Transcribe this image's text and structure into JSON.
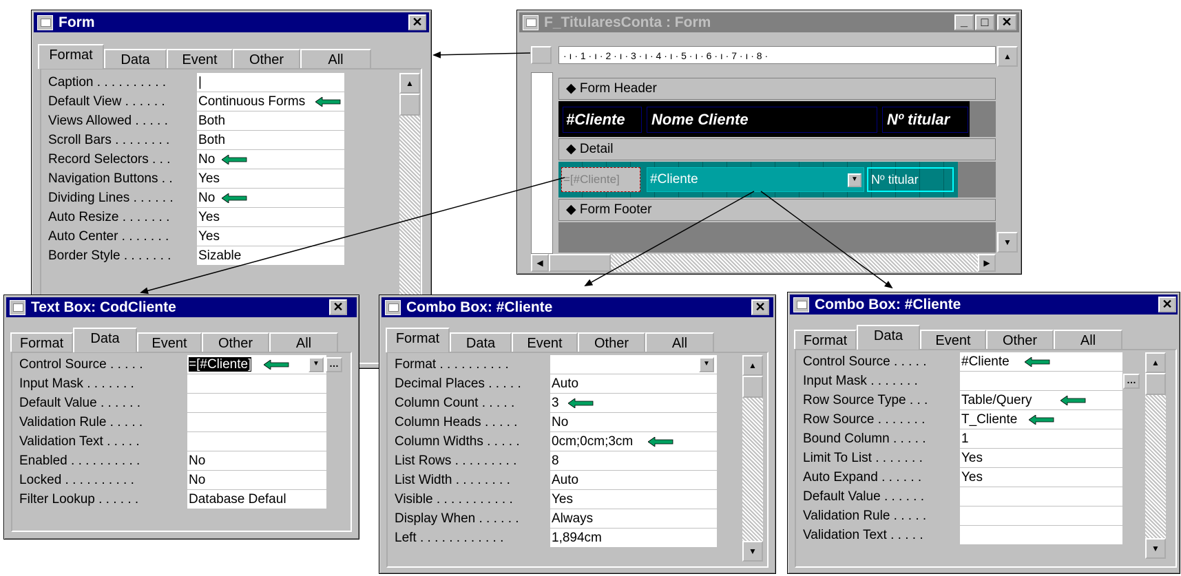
{
  "colors": {
    "titlebar": "#000080",
    "accent_arrow": "#00a060",
    "teal": "#008080",
    "detail_cell": "#00a0a0"
  },
  "form_props": {
    "title": "Form",
    "tabs": [
      "Format",
      "Data",
      "Event",
      "Other",
      "All"
    ],
    "active_tab": "Format",
    "rows": [
      {
        "label": "Caption . . . . . . . . . .",
        "value": "|"
      },
      {
        "label": "Default View . . . . . .",
        "value": "Continuous Forms",
        "arrow": true
      },
      {
        "label": "Views Allowed . . . . .",
        "value": "Both"
      },
      {
        "label": "Scroll Bars . . . . . . . .",
        "value": "Both"
      },
      {
        "label": "Record Selectors . . .",
        "value": "No",
        "arrow": true
      },
      {
        "label": "Navigation Buttons . .",
        "value": "Yes"
      },
      {
        "label": "Dividing Lines . . . . . .",
        "value": "No",
        "arrow": true
      },
      {
        "label": "Auto Resize . . . . . . .",
        "value": "Yes"
      },
      {
        "label": "Auto Center . . . . . . .",
        "value": "Yes"
      },
      {
        "label": "Border Style . . . . . . .",
        "value": "Sizable"
      }
    ]
  },
  "form_design": {
    "title": "F_TitularesConta : Form",
    "ruler": "· ı · 1 · ı · 2 · ı · 3 · ı · 4 · ı · 5 · ı · 6 · ı · 7 · ı · 8 ·",
    "header_label": "Form Header",
    "detail_label": "Detail",
    "footer_label": "Form Footer",
    "header_cells": [
      "#Cliente",
      "Nome Cliente",
      "Nº titular"
    ],
    "detail_cells": [
      "=[#Cliente]",
      "#Cliente",
      "Nº titular"
    ]
  },
  "textbox_props": {
    "title": "Text Box: CodCliente",
    "tabs": [
      "Format",
      "Data",
      "Event",
      "Other",
      "All"
    ],
    "active_tab": "Data",
    "rows": [
      {
        "label": "Control Source . . . . .",
        "value": "=[#Cliente]",
        "arrow": true
      },
      {
        "label": "Input Mask . . . . . . .",
        "value": ""
      },
      {
        "label": "Default Value . . . . . .",
        "value": ""
      },
      {
        "label": "Validation Rule . . . . .",
        "value": ""
      },
      {
        "label": "Validation Text . . . . .",
        "value": ""
      },
      {
        "label": "Enabled . . . . . . . . . .",
        "value": "No"
      },
      {
        "label": "Locked . . . . . . . . . .",
        "value": "No"
      },
      {
        "label": "Filter Lookup . . . . . .",
        "value": "Database Defaul"
      }
    ]
  },
  "combo_format": {
    "title": "Combo Box: #Cliente",
    "tabs": [
      "Format",
      "Data",
      "Event",
      "Other",
      "All"
    ],
    "active_tab": "Format",
    "rows": [
      {
        "label": "Format . . . . . . . . . .",
        "value": ""
      },
      {
        "label": "Decimal Places . . . . .",
        "value": "Auto"
      },
      {
        "label": "Column Count . . . . .",
        "value": "3",
        "arrow": true
      },
      {
        "label": "Column Heads . . . . .",
        "value": "No"
      },
      {
        "label": "Column Widths . . . . .",
        "value": "0cm;0cm;3cm",
        "arrow": true
      },
      {
        "label": "List Rows . . . . . . . . .",
        "value": "8"
      },
      {
        "label": "List Width . . . . . . . .",
        "value": "Auto"
      },
      {
        "label": "Visible . . . . . . . . . . .",
        "value": "Yes"
      },
      {
        "label": "Display When . . . . . .",
        "value": "Always"
      },
      {
        "label": "Left . . . . . . . . . . . .",
        "value": "1,894cm"
      }
    ]
  },
  "combo_data": {
    "title": "Combo Box: #Cliente",
    "tabs": [
      "Format",
      "Data",
      "Event",
      "Other",
      "All"
    ],
    "active_tab": "Data",
    "rows": [
      {
        "label": "Control Source . . . . .",
        "value": "#Cliente",
        "arrow": true
      },
      {
        "label": "Input Mask . . . . . . .",
        "value": ""
      },
      {
        "label": "Row Source Type . . .",
        "value": "Table/Query",
        "arrow": true
      },
      {
        "label": "Row Source . . . . . . .",
        "value": "T_Cliente",
        "arrow": true
      },
      {
        "label": "Bound Column . . . . .",
        "value": "1"
      },
      {
        "label": "Limit To List . . . . . . .",
        "value": "Yes"
      },
      {
        "label": "Auto Expand . . . . . .",
        "value": "Yes"
      },
      {
        "label": "Default Value . . . . . .",
        "value": ""
      },
      {
        "label": "Validation Rule . . . . .",
        "value": ""
      },
      {
        "label": "Validation Text . . . . .",
        "value": ""
      }
    ]
  }
}
